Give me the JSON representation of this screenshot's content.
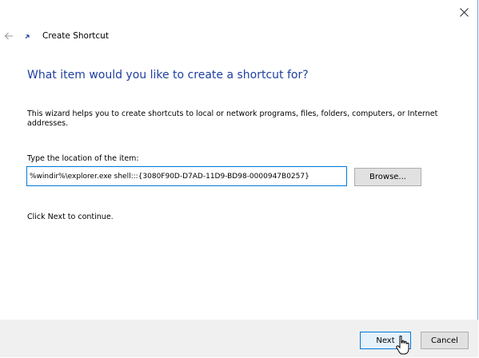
{
  "header": {
    "title": "Create Shortcut"
  },
  "main": {
    "question": "What item would you like to create a shortcut for?",
    "description": "This wizard helps you to create shortcuts to local or network programs, files, folders, computers, or Internet addresses.",
    "location_label": "Type the location of the item:",
    "location_value": "%windir%\\explorer.exe shell:::{3080F90D-D7AD-11D9-BD98-0000947B0257}",
    "browse_label": "Browse...",
    "continue_text": "Click Next to continue."
  },
  "footer": {
    "next_label": "Next",
    "cancel_label": "Cancel"
  },
  "icons": {
    "close": "close-icon",
    "back": "back-arrow-icon",
    "shortcut": "shortcut-icon",
    "cursor": "mouse-cursor-icon"
  },
  "colors": {
    "accent": "#0078d7",
    "heading": "#1f3fa0",
    "footer_bg": "#f0f0f0"
  }
}
